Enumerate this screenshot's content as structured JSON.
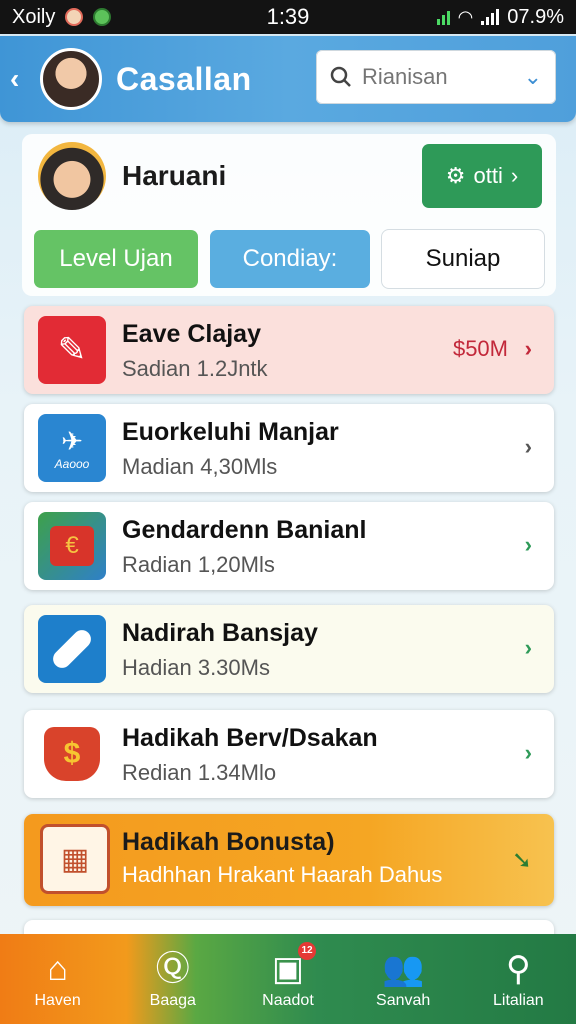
{
  "status_bar": {
    "carrier": "Xoily",
    "time": "1:39",
    "battery": "07.9%"
  },
  "header": {
    "back_glyph": "‹",
    "title": "Casallan",
    "search": {
      "placeholder": "Rianisan",
      "value": ""
    }
  },
  "profile": {
    "name": "Haruani",
    "action_label": "otti",
    "pills": [
      "Level Ujan",
      "Condiay:",
      "Suniap"
    ]
  },
  "items": [
    {
      "title": "Eave Clajay",
      "subtitle": "Sadian 1.2Jntk",
      "price": "$50M",
      "icon": "pencil-icon"
    },
    {
      "title": "Euorkeluhi Manjar",
      "subtitle": "Madian 4,30Mls",
      "icon": "plane-icon",
      "icon_label": "Aaooo"
    },
    {
      "title": "Gendardenn Banianl",
      "subtitle": "Radian 1,20Mls",
      "icon": "shopping-bag-icon"
    },
    {
      "title": "Nadirah Bansjay",
      "subtitle": "Hadian 3.30Ms",
      "icon": "bandage-icon"
    },
    {
      "title": "Hadikah Berv/Dsakan",
      "subtitle": "Redian 1.34Mlo",
      "icon": "money-bag-icon"
    }
  ],
  "bonus": {
    "title": "Hadikah Bonusta)",
    "subtitle": "Hadhhan Hrakant Haarah Dahus",
    "icon": "calendar-icon"
  },
  "nav": [
    {
      "label": "Haven",
      "icon": "home-icon"
    },
    {
      "label": "Baaga",
      "icon": "search-chat-icon"
    },
    {
      "label": "Naadot",
      "icon": "box-icon",
      "badge": "12"
    },
    {
      "label": "Sanvah",
      "icon": "users-icon"
    },
    {
      "label": "Litalian",
      "icon": "search-icon"
    }
  ],
  "colors": {
    "header_blue": "#4f9fdb",
    "green": "#2e9a58",
    "orange": "#f49a1e",
    "red_price": "#c2283a"
  }
}
